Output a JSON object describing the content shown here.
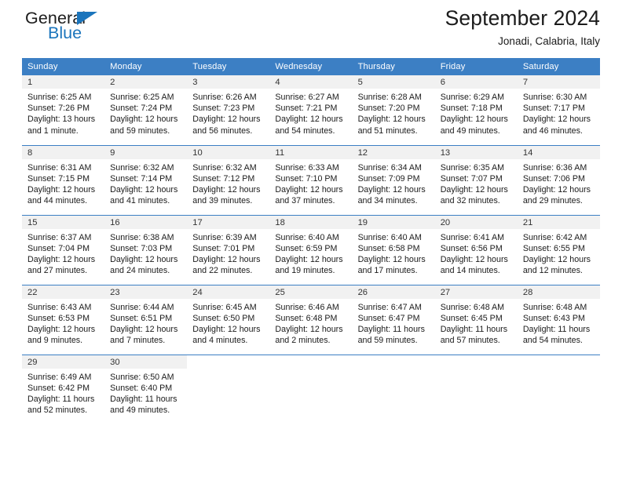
{
  "brand": {
    "name_part1": "General",
    "name_part2": "Blue",
    "triangle_icon": "triangle-icon",
    "accent_color": "#1b75bc"
  },
  "header": {
    "title": "September 2024",
    "subtitle": "Jonadi, Calabria, Italy"
  },
  "theme": {
    "header_row_bg": "#3c7fc4",
    "daynum_band_bg": "#f1f1f1",
    "grid_line": "#3c7fc4",
    "text": "#1b1b1b"
  },
  "weekdays": [
    "Sunday",
    "Monday",
    "Tuesday",
    "Wednesday",
    "Thursday",
    "Friday",
    "Saturday"
  ],
  "labels": {
    "sunrise_prefix": "Sunrise:",
    "sunset_prefix": "Sunset:",
    "daylight_prefix": "Daylight:"
  },
  "days": [
    {
      "n": "1",
      "l1": "Sunrise: 6:25 AM",
      "l2": "Sunset: 7:26 PM",
      "l3": "Daylight: 13 hours",
      "l4": "and 1 minute.",
      "sunrise": "6:25 AM",
      "sunset": "7:26 PM",
      "daylight": "13 hours and 1 minute"
    },
    {
      "n": "2",
      "l1": "Sunrise: 6:25 AM",
      "l2": "Sunset: 7:24 PM",
      "l3": "Daylight: 12 hours",
      "l4": "and 59 minutes.",
      "sunrise": "6:25 AM",
      "sunset": "7:24 PM",
      "daylight": "12 hours and 59 minutes"
    },
    {
      "n": "3",
      "l1": "Sunrise: 6:26 AM",
      "l2": "Sunset: 7:23 PM",
      "l3": "Daylight: 12 hours",
      "l4": "and 56 minutes.",
      "sunrise": "6:26 AM",
      "sunset": "7:23 PM",
      "daylight": "12 hours and 56 minutes"
    },
    {
      "n": "4",
      "l1": "Sunrise: 6:27 AM",
      "l2": "Sunset: 7:21 PM",
      "l3": "Daylight: 12 hours",
      "l4": "and 54 minutes.",
      "sunrise": "6:27 AM",
      "sunset": "7:21 PM",
      "daylight": "12 hours and 54 minutes"
    },
    {
      "n": "5",
      "l1": "Sunrise: 6:28 AM",
      "l2": "Sunset: 7:20 PM",
      "l3": "Daylight: 12 hours",
      "l4": "and 51 minutes.",
      "sunrise": "6:28 AM",
      "sunset": "7:20 PM",
      "daylight": "12 hours and 51 minutes"
    },
    {
      "n": "6",
      "l1": "Sunrise: 6:29 AM",
      "l2": "Sunset: 7:18 PM",
      "l3": "Daylight: 12 hours",
      "l4": "and 49 minutes.",
      "sunrise": "6:29 AM",
      "sunset": "7:18 PM",
      "daylight": "12 hours and 49 minutes"
    },
    {
      "n": "7",
      "l1": "Sunrise: 6:30 AM",
      "l2": "Sunset: 7:17 PM",
      "l3": "Daylight: 12 hours",
      "l4": "and 46 minutes.",
      "sunrise": "6:30 AM",
      "sunset": "7:17 PM",
      "daylight": "12 hours and 46 minutes"
    },
    {
      "n": "8",
      "l1": "Sunrise: 6:31 AM",
      "l2": "Sunset: 7:15 PM",
      "l3": "Daylight: 12 hours",
      "l4": "and 44 minutes.",
      "sunrise": "6:31 AM",
      "sunset": "7:15 PM",
      "daylight": "12 hours and 44 minutes"
    },
    {
      "n": "9",
      "l1": "Sunrise: 6:32 AM",
      "l2": "Sunset: 7:14 PM",
      "l3": "Daylight: 12 hours",
      "l4": "and 41 minutes.",
      "sunrise": "6:32 AM",
      "sunset": "7:14 PM",
      "daylight": "12 hours and 41 minutes"
    },
    {
      "n": "10",
      "l1": "Sunrise: 6:32 AM",
      "l2": "Sunset: 7:12 PM",
      "l3": "Daylight: 12 hours",
      "l4": "and 39 minutes.",
      "sunrise": "6:32 AM",
      "sunset": "7:12 PM",
      "daylight": "12 hours and 39 minutes"
    },
    {
      "n": "11",
      "l1": "Sunrise: 6:33 AM",
      "l2": "Sunset: 7:10 PM",
      "l3": "Daylight: 12 hours",
      "l4": "and 37 minutes.",
      "sunrise": "6:33 AM",
      "sunset": "7:10 PM",
      "daylight": "12 hours and 37 minutes"
    },
    {
      "n": "12",
      "l1": "Sunrise: 6:34 AM",
      "l2": "Sunset: 7:09 PM",
      "l3": "Daylight: 12 hours",
      "l4": "and 34 minutes.",
      "sunrise": "6:34 AM",
      "sunset": "7:09 PM",
      "daylight": "12 hours and 34 minutes"
    },
    {
      "n": "13",
      "l1": "Sunrise: 6:35 AM",
      "l2": "Sunset: 7:07 PM",
      "l3": "Daylight: 12 hours",
      "l4": "and 32 minutes.",
      "sunrise": "6:35 AM",
      "sunset": "7:07 PM",
      "daylight": "12 hours and 32 minutes"
    },
    {
      "n": "14",
      "l1": "Sunrise: 6:36 AM",
      "l2": "Sunset: 7:06 PM",
      "l3": "Daylight: 12 hours",
      "l4": "and 29 minutes.",
      "sunrise": "6:36 AM",
      "sunset": "7:06 PM",
      "daylight": "12 hours and 29 minutes"
    },
    {
      "n": "15",
      "l1": "Sunrise: 6:37 AM",
      "l2": "Sunset: 7:04 PM",
      "l3": "Daylight: 12 hours",
      "l4": "and 27 minutes.",
      "sunrise": "6:37 AM",
      "sunset": "7:04 PM",
      "daylight": "12 hours and 27 minutes"
    },
    {
      "n": "16",
      "l1": "Sunrise: 6:38 AM",
      "l2": "Sunset: 7:03 PM",
      "l3": "Daylight: 12 hours",
      "l4": "and 24 minutes.",
      "sunrise": "6:38 AM",
      "sunset": "7:03 PM",
      "daylight": "12 hours and 24 minutes"
    },
    {
      "n": "17",
      "l1": "Sunrise: 6:39 AM",
      "l2": "Sunset: 7:01 PM",
      "l3": "Daylight: 12 hours",
      "l4": "and 22 minutes.",
      "sunrise": "6:39 AM",
      "sunset": "7:01 PM",
      "daylight": "12 hours and 22 minutes"
    },
    {
      "n": "18",
      "l1": "Sunrise: 6:40 AM",
      "l2": "Sunset: 6:59 PM",
      "l3": "Daylight: 12 hours",
      "l4": "and 19 minutes.",
      "sunrise": "6:40 AM",
      "sunset": "6:59 PM",
      "daylight": "12 hours and 19 minutes"
    },
    {
      "n": "19",
      "l1": "Sunrise: 6:40 AM",
      "l2": "Sunset: 6:58 PM",
      "l3": "Daylight: 12 hours",
      "l4": "and 17 minutes.",
      "sunrise": "6:40 AM",
      "sunset": "6:58 PM",
      "daylight": "12 hours and 17 minutes"
    },
    {
      "n": "20",
      "l1": "Sunrise: 6:41 AM",
      "l2": "Sunset: 6:56 PM",
      "l3": "Daylight: 12 hours",
      "l4": "and 14 minutes.",
      "sunrise": "6:41 AM",
      "sunset": "6:56 PM",
      "daylight": "12 hours and 14 minutes"
    },
    {
      "n": "21",
      "l1": "Sunrise: 6:42 AM",
      "l2": "Sunset: 6:55 PM",
      "l3": "Daylight: 12 hours",
      "l4": "and 12 minutes.",
      "sunrise": "6:42 AM",
      "sunset": "6:55 PM",
      "daylight": "12 hours and 12 minutes"
    },
    {
      "n": "22",
      "l1": "Sunrise: 6:43 AM",
      "l2": "Sunset: 6:53 PM",
      "l3": "Daylight: 12 hours",
      "l4": "and 9 minutes.",
      "sunrise": "6:43 AM",
      "sunset": "6:53 PM",
      "daylight": "12 hours and 9 minutes"
    },
    {
      "n": "23",
      "l1": "Sunrise: 6:44 AM",
      "l2": "Sunset: 6:51 PM",
      "l3": "Daylight: 12 hours",
      "l4": "and 7 minutes.",
      "sunrise": "6:44 AM",
      "sunset": "6:51 PM",
      "daylight": "12 hours and 7 minutes"
    },
    {
      "n": "24",
      "l1": "Sunrise: 6:45 AM",
      "l2": "Sunset: 6:50 PM",
      "l3": "Daylight: 12 hours",
      "l4": "and 4 minutes.",
      "sunrise": "6:45 AM",
      "sunset": "6:50 PM",
      "daylight": "12 hours and 4 minutes"
    },
    {
      "n": "25",
      "l1": "Sunrise: 6:46 AM",
      "l2": "Sunset: 6:48 PM",
      "l3": "Daylight: 12 hours",
      "l4": "and 2 minutes.",
      "sunrise": "6:46 AM",
      "sunset": "6:48 PM",
      "daylight": "12 hours and 2 minutes"
    },
    {
      "n": "26",
      "l1": "Sunrise: 6:47 AM",
      "l2": "Sunset: 6:47 PM",
      "l3": "Daylight: 11 hours",
      "l4": "and 59 minutes.",
      "sunrise": "6:47 AM",
      "sunset": "6:47 PM",
      "daylight": "11 hours and 59 minutes"
    },
    {
      "n": "27",
      "l1": "Sunrise: 6:48 AM",
      "l2": "Sunset: 6:45 PM",
      "l3": "Daylight: 11 hours",
      "l4": "and 57 minutes.",
      "sunrise": "6:48 AM",
      "sunset": "6:45 PM",
      "daylight": "11 hours and 57 minutes"
    },
    {
      "n": "28",
      "l1": "Sunrise: 6:48 AM",
      "l2": "Sunset: 6:43 PM",
      "l3": "Daylight: 11 hours",
      "l4": "and 54 minutes.",
      "sunrise": "6:48 AM",
      "sunset": "6:43 PM",
      "daylight": "11 hours and 54 minutes"
    },
    {
      "n": "29",
      "l1": "Sunrise: 6:49 AM",
      "l2": "Sunset: 6:42 PM",
      "l3": "Daylight: 11 hours",
      "l4": "and 52 minutes.",
      "sunrise": "6:49 AM",
      "sunset": "6:42 PM",
      "daylight": "11 hours and 52 minutes"
    },
    {
      "n": "30",
      "l1": "Sunrise: 6:50 AM",
      "l2": "Sunset: 6:40 PM",
      "l3": "Daylight: 11 hours",
      "l4": "and 49 minutes.",
      "sunrise": "6:50 AM",
      "sunset": "6:40 PM",
      "daylight": "11 hours and 49 minutes"
    }
  ]
}
